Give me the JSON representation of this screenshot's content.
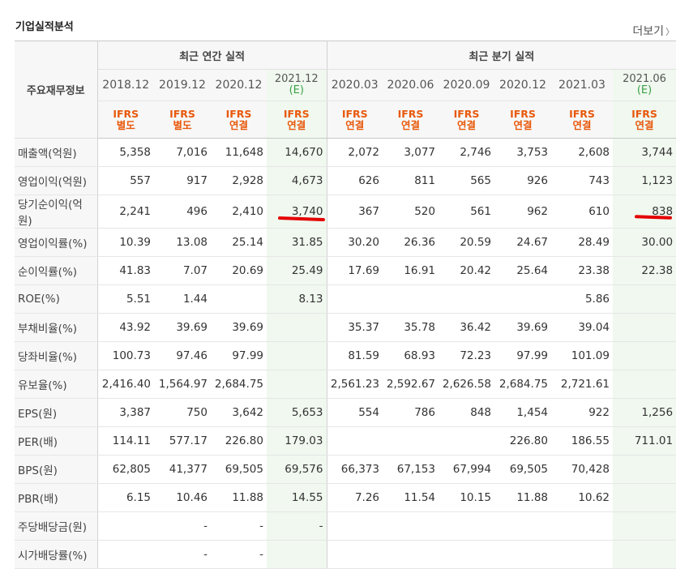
{
  "page_title": "기업실적분석",
  "more_link": "더보기",
  "more_chevron": "〉",
  "table": {
    "corner_label": "주요재무정보",
    "annual_group": "최근 연간 실적",
    "quarter_group": "최근 분기 실적",
    "periods": [
      {
        "label": "2018.12",
        "sub": "",
        "std1": "IFRS",
        "std2": "별도"
      },
      {
        "label": "2019.12",
        "sub": "",
        "std1": "IFRS",
        "std2": "별도"
      },
      {
        "label": "2020.12",
        "sub": "",
        "std1": "IFRS",
        "std2": "연결"
      },
      {
        "label": "2021.12",
        "sub": "(E)",
        "std1": "IFRS",
        "std2": "연결"
      },
      {
        "label": "2020.03",
        "sub": "",
        "std1": "IFRS",
        "std2": "연결"
      },
      {
        "label": "2020.06",
        "sub": "",
        "std1": "IFRS",
        "std2": "연결"
      },
      {
        "label": "2020.09",
        "sub": "",
        "std1": "IFRS",
        "std2": "연결"
      },
      {
        "label": "2020.12",
        "sub": "",
        "std1": "IFRS",
        "std2": "연결"
      },
      {
        "label": "2021.03",
        "sub": "",
        "std1": "IFRS",
        "std2": "연결"
      },
      {
        "label": "2021.06",
        "sub": "(E)",
        "std1": "IFRS",
        "std2": "연결"
      }
    ],
    "rows": [
      {
        "label": "매출액(억원)",
        "values": [
          "5,358",
          "7,016",
          "11,648",
          "14,670",
          "2,072",
          "3,077",
          "2,746",
          "3,753",
          "2,608",
          "3,744"
        ]
      },
      {
        "label": "영업이익(억원)",
        "values": [
          "557",
          "917",
          "2,928",
          "4,673",
          "626",
          "811",
          "565",
          "926",
          "743",
          "1,123"
        ]
      },
      {
        "label": "당기순이익(억원)",
        "values": [
          "2,241",
          "496",
          "2,410",
          "3,740",
          "367",
          "520",
          "561",
          "962",
          "610",
          "838"
        ]
      },
      {
        "label": "영업이익률(%)",
        "values": [
          "10.39",
          "13.08",
          "25.14",
          "31.85",
          "30.20",
          "26.36",
          "20.59",
          "24.67",
          "28.49",
          "30.00"
        ]
      },
      {
        "label": "순이익률(%)",
        "values": [
          "41.83",
          "7.07",
          "20.69",
          "25.49",
          "17.69",
          "16.91",
          "20.42",
          "25.64",
          "23.38",
          "22.38"
        ]
      },
      {
        "label": "ROE(%)",
        "values": [
          "5.51",
          "1.44",
          "",
          "8.13",
          "",
          "",
          "",
          "",
          "5.86",
          ""
        ]
      },
      {
        "label": "부채비율(%)",
        "values": [
          "43.92",
          "39.69",
          "39.69",
          "",
          "35.37",
          "35.78",
          "36.42",
          "39.69",
          "39.04",
          ""
        ]
      },
      {
        "label": "당좌비율(%)",
        "values": [
          "100.73",
          "97.46",
          "97.99",
          "",
          "81.59",
          "68.93",
          "72.23",
          "97.99",
          "101.09",
          ""
        ]
      },
      {
        "label": "유보율(%)",
        "values": [
          "2,416.40",
          "1,564.97",
          "2,684.75",
          "",
          "2,561.23",
          "2,592.67",
          "2,626.58",
          "2,684.75",
          "2,721.61",
          ""
        ]
      },
      {
        "label": "EPS(원)",
        "values": [
          "3,387",
          "750",
          "3,642",
          "5,653",
          "554",
          "786",
          "848",
          "1,454",
          "922",
          "1,256"
        ]
      },
      {
        "label": "PER(배)",
        "values": [
          "114.11",
          "577.17",
          "226.80",
          "179.03",
          "",
          "",
          "",
          "226.80",
          "186.55",
          "711.01"
        ]
      },
      {
        "label": "BPS(원)",
        "values": [
          "62,805",
          "41,377",
          "69,505",
          "69,576",
          "66,373",
          "67,153",
          "67,994",
          "69,505",
          "70,428",
          ""
        ]
      },
      {
        "label": "PBR(배)",
        "values": [
          "6.15",
          "10.46",
          "11.88",
          "14.55",
          "7.26",
          "11.54",
          "10.15",
          "11.88",
          "10.62",
          ""
        ]
      },
      {
        "label": "주당배당금(원)",
        "values": [
          "",
          "-",
          "-",
          "-",
          "",
          "",
          "",
          "",
          "",
          ""
        ]
      },
      {
        "label": "시가배당률(%)",
        "values": [
          "",
          "-",
          "-",
          "",
          "",
          "",
          "",
          "",
          "",
          ""
        ]
      }
    ]
  },
  "colors": {
    "accent_orange": "#e8590c",
    "estimate_bg": "#f0f8ef",
    "underline_red": "#e40000"
  }
}
